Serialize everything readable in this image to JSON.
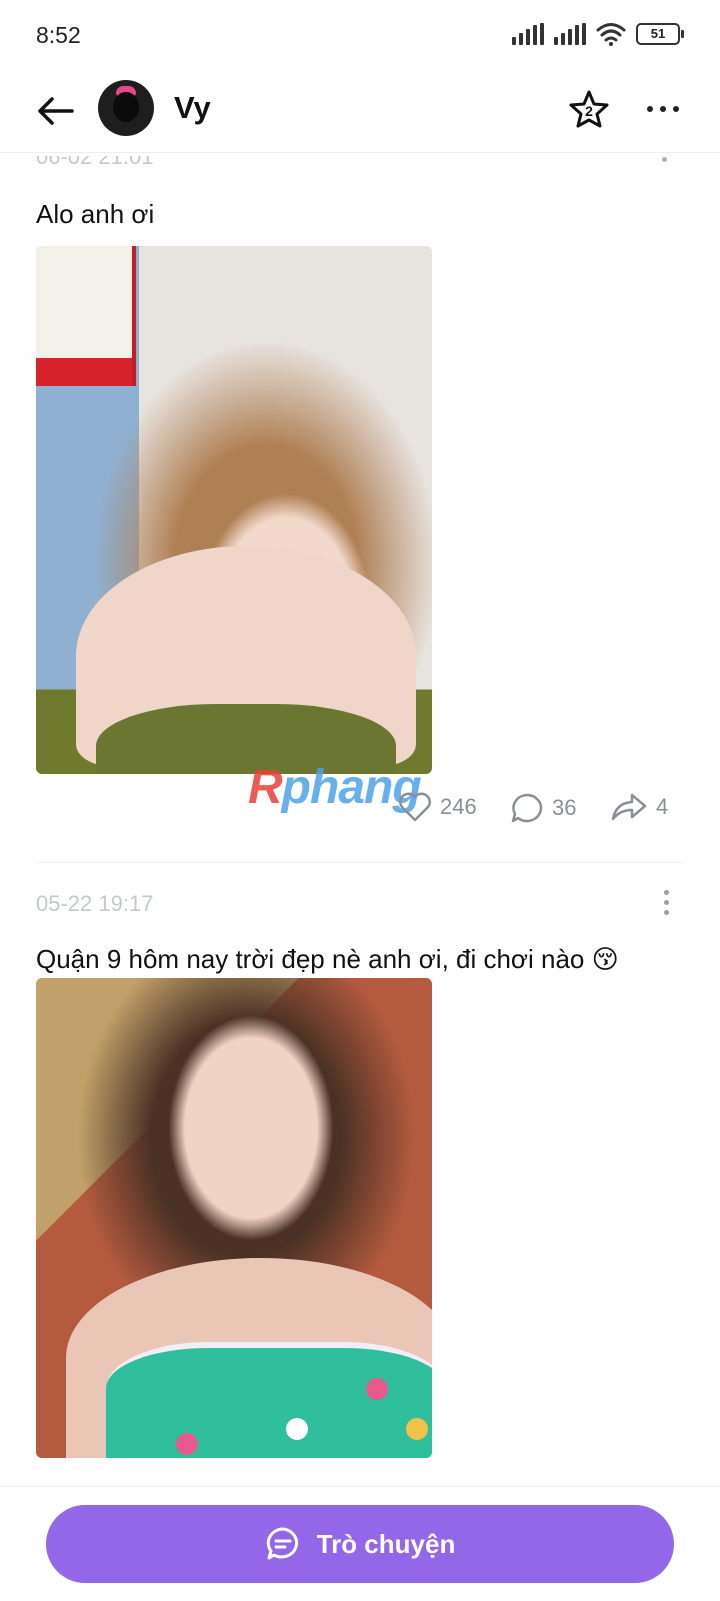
{
  "status_bar": {
    "time": "8:52",
    "battery": "51",
    "icons": [
      "signal-icon",
      "signal-icon",
      "wifi-icon",
      "battery-icon"
    ]
  },
  "header": {
    "name": "Vy",
    "star_badge": "2",
    "icons": [
      "back-arrow-icon",
      "star-icon",
      "more-icon"
    ]
  },
  "posts": [
    {
      "timestamp": "06-02 21:01",
      "text": "Alo anh ơi",
      "likes": "246",
      "comments": "36",
      "shares": "4"
    },
    {
      "timestamp": "05-22 19:17",
      "text": "Quận 9 hôm nay trời đẹp nè anh ơi, đi chơi nào 😚"
    }
  ],
  "watermark": {
    "part1": "R",
    "part2": "phang"
  },
  "bottom_bar": {
    "chat_label": "Trò chuyện",
    "accent": "#9466e8"
  }
}
